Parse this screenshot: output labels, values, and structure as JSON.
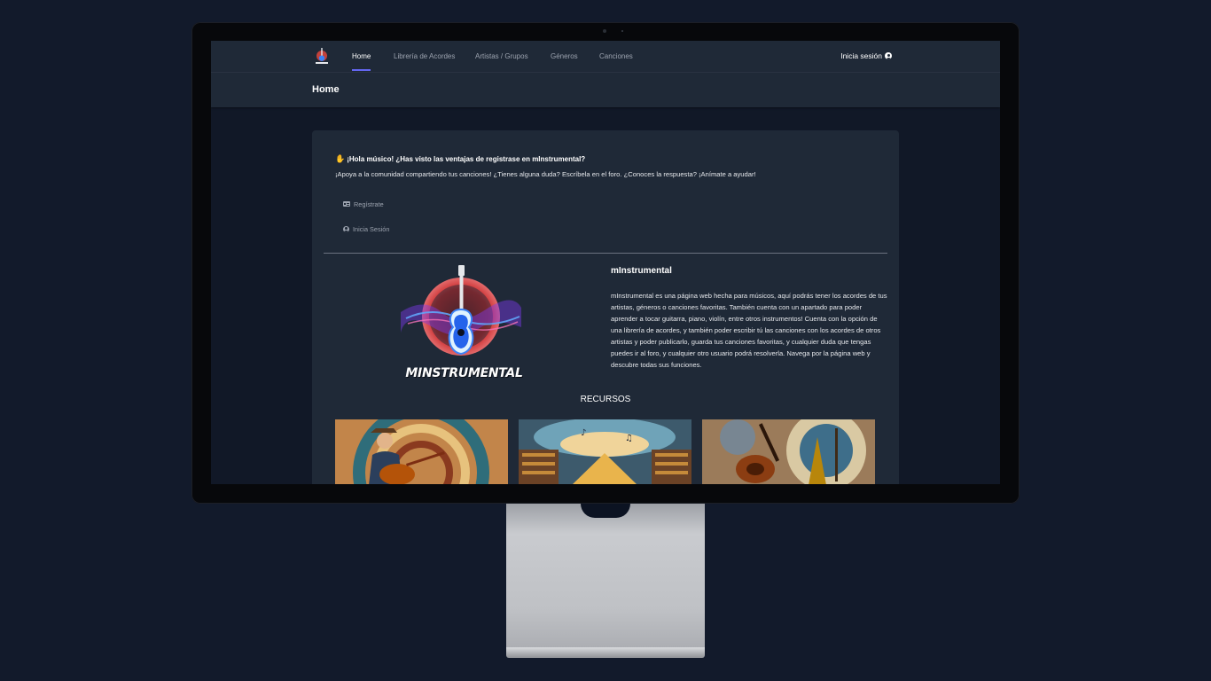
{
  "nav": {
    "items": [
      {
        "label": "Home",
        "active": true
      },
      {
        "label": "Librería de Acordes",
        "active": false
      },
      {
        "label": "Artistas / Grupos",
        "active": false
      },
      {
        "label": "Géneros",
        "active": false
      },
      {
        "label": "Canciones",
        "active": false
      }
    ],
    "login_label": "Inicia sesión"
  },
  "header": {
    "title": "Home"
  },
  "welcome": {
    "greeting": "¡Hola músico! ¿Has visto las ventajas de registrase en mInstrumental?",
    "message": "¡Apoya a la comunidad compartiendo tus canciones! ¿Tienes alguna duda? Escríbela en el foro. ¿Conoces la respuesta? ¡Anímate a ayudar!",
    "register_label": "Regístrate",
    "login_label": "Inicia Sesión"
  },
  "about": {
    "wordmark": "MINSTRUMENTAL",
    "title": "mInstrumental",
    "text": "mInstrumental es una página web hecha para músicos, aquí podrás tener los acordes de tus artistas, géneros o canciones favoritas. También cuenta con un apartado para poder aprender a tocar guitarra, piano, violín, entre otros instrumentos! Cuenta con la opción de una librería de acordes, y también poder escribir tú las canciones con los acordes de otros artistas y poder publicarlo, guarda tus canciones favoritas, y cualquier duda que tengas puedes ir al foro, y cualquier otro usuario podrá resolverla. Navega por la página web y descubre todas sus funciones."
  },
  "resources": {
    "title": "RECURSOS"
  },
  "colors": {
    "page_bg": "#121a2b",
    "screen_bg": "#111827",
    "panel_bg": "#1f2937",
    "accent": "#6366f1"
  }
}
